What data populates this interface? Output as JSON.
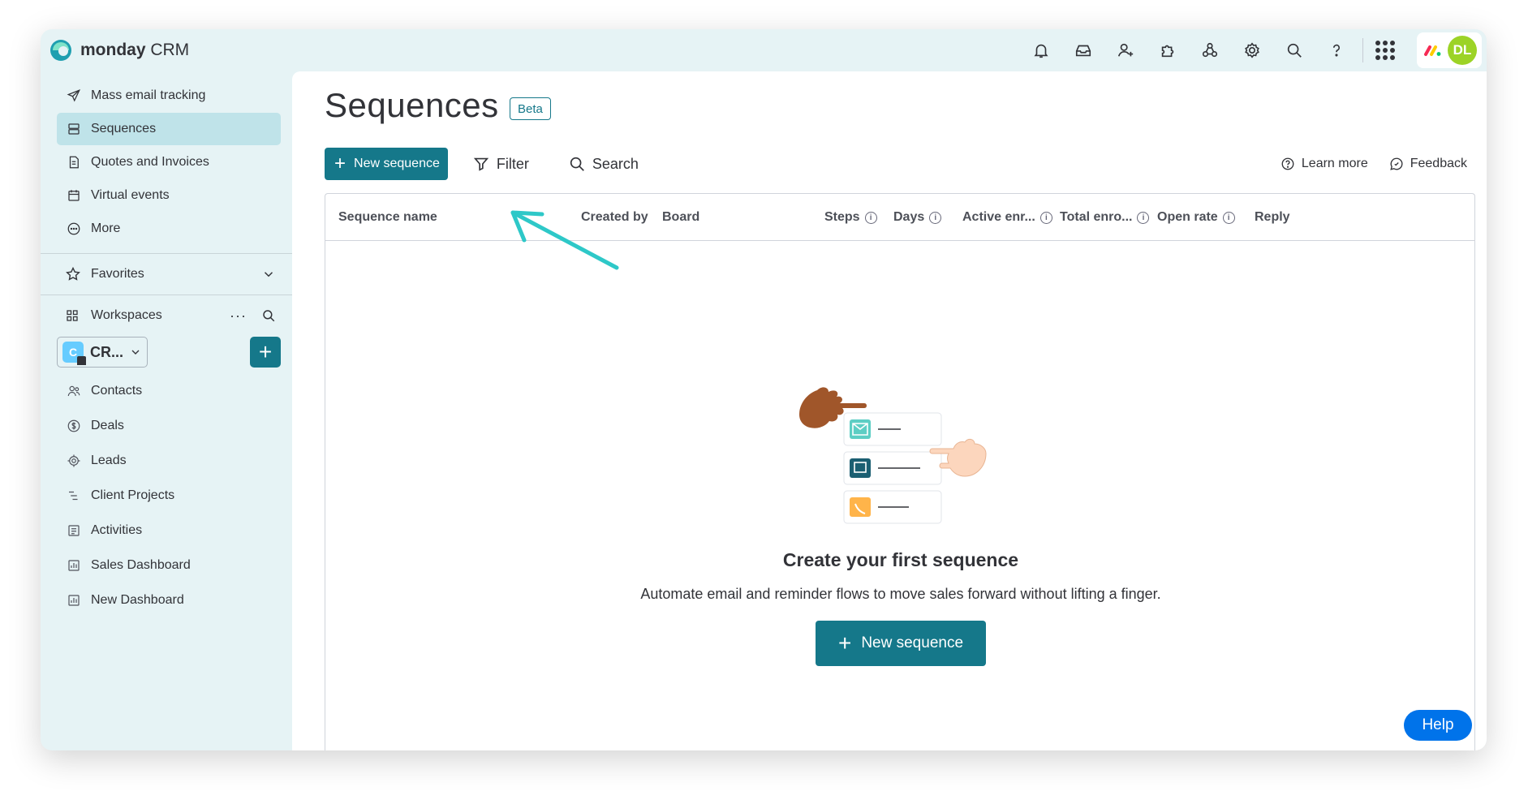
{
  "app": {
    "logo_bold": "monday",
    "logo_rest": " CRM",
    "avatar_initials": "DL"
  },
  "topbar": {
    "icons": [
      "bell-icon",
      "inbox-icon",
      "invite-user-icon",
      "apps-puzzle-icon",
      "integrations-icon",
      "settings-gear-icon",
      "search-icon",
      "help-question-icon",
      "apps-grid-icon"
    ]
  },
  "sidebar": {
    "items": [
      {
        "label": "Mass email tracking",
        "icon": "send-icon"
      },
      {
        "label": "Sequences",
        "icon": "sequence-icon",
        "active": true
      },
      {
        "label": "Quotes and Invoices",
        "icon": "invoice-icon"
      },
      {
        "label": "Virtual events",
        "icon": "calendar-icon"
      },
      {
        "label": "More",
        "icon": "more-circle-icon"
      }
    ],
    "favorites_label": "Favorites",
    "workspaces_label": "Workspaces",
    "workspace_name": "CR...",
    "workspace_badge": "C",
    "workspace_items": [
      {
        "label": "Contacts",
        "icon": "contacts-icon"
      },
      {
        "label": "Deals",
        "icon": "dollar-icon"
      },
      {
        "label": "Leads",
        "icon": "target-icon"
      },
      {
        "label": "Client Projects",
        "icon": "gantt-icon"
      },
      {
        "label": "Activities",
        "icon": "list-icon"
      },
      {
        "label": "Sales Dashboard",
        "icon": "dashboard-icon"
      },
      {
        "label": "New Dashboard",
        "icon": "dashboard-icon"
      }
    ]
  },
  "main": {
    "title": "Sequences",
    "badge": "Beta",
    "toolbar": {
      "new_sequence": "New sequence",
      "filter": "Filter",
      "search": "Search",
      "learn_more": "Learn more",
      "feedback": "Feedback"
    },
    "columns": [
      "Sequence name",
      "Created by",
      "Board",
      "Steps",
      "Days",
      "Active enr...",
      "Total enro...",
      "Open rate",
      "Reply"
    ],
    "empty": {
      "title": "Create your first sequence",
      "subtitle": "Automate email and reminder flows to move sales forward without lifting a finger.",
      "button": "New sequence"
    },
    "help": "Help"
  },
  "colors": {
    "accent": "#15788a",
    "sidebar_bg": "#e6f3f5",
    "active_item": "#bfe3e9",
    "help": "#0073ea",
    "annotation_arrow": "#2ec8c8"
  }
}
